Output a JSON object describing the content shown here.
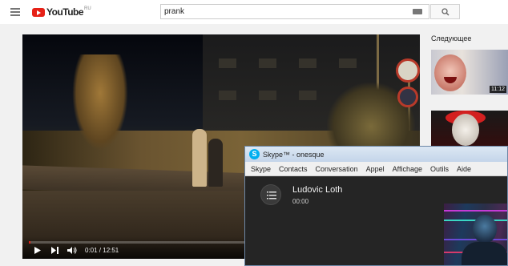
{
  "youtube": {
    "logo_text": "YouTube",
    "region": "RU",
    "search_query": "prank",
    "up_next_label": "Следующее",
    "video": {
      "current_time": "0:01",
      "duration": "12:51",
      "time_display": "0:01 / 12:51",
      "progress": 0.0013
    },
    "recommendations": [
      {
        "duration": "11:12"
      },
      {
        "duration": ""
      }
    ]
  },
  "skype": {
    "window_title": "Skype™ - onesque",
    "menu": [
      "Skype",
      "Contacts",
      "Conversation",
      "Appel",
      "Affichage",
      "Outils",
      "Aide"
    ],
    "caller_name": "Ludovic Loth",
    "call_timer": "00:00"
  },
  "colors": {
    "youtube_red": "#e62117",
    "skype_blue": "#00aff0"
  }
}
